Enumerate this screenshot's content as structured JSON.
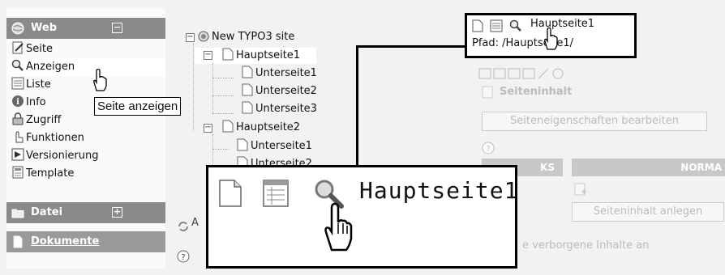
{
  "menu": {
    "web_label": "Web",
    "web_toggle": "−",
    "items": [
      {
        "label": "Seite",
        "icon": "page-edit-icon"
      },
      {
        "label": "Anzeigen",
        "icon": "magnifier-icon"
      },
      {
        "label": "Liste",
        "icon": "list-icon"
      },
      {
        "label": "Info",
        "icon": "info-icon"
      },
      {
        "label": "Zugriff",
        "icon": "lock-icon"
      },
      {
        "label": "Funktionen",
        "icon": "functions-icon"
      },
      {
        "label": "Versionierung",
        "icon": "versioning-icon"
      },
      {
        "label": "Template",
        "icon": "template-icon"
      }
    ],
    "datei_label": "Datei",
    "datei_toggle": "+",
    "dokumente_label": "Dokumente"
  },
  "tooltip": "Seite anzeigen",
  "tree": {
    "root": "New TYPO3 site",
    "nodes": [
      "Hauptseite1",
      "Unterseite1",
      "Unterseite2",
      "Unterseite3",
      "Hauptseite2",
      "Unterseite1",
      "Unterseite2"
    ],
    "footer_partial": "A"
  },
  "content": {
    "seiteninhalt_label": "Seiteninhalt",
    "seiteneigenschaften_button": "Seiteneigenschaften bearbeiten",
    "col_left_partial": "KS",
    "col_right_partial": "NORMA",
    "seiteninhalt_anlegen_button": "Seiteninhalt anlegen",
    "hidden_note_partial": "e verborgene Inhalte an"
  },
  "callout_small": {
    "title": "Hauptseite1",
    "path": "Pfad: /Hauptseite1/"
  },
  "callout_big": {
    "title": "Hauptseite1"
  }
}
